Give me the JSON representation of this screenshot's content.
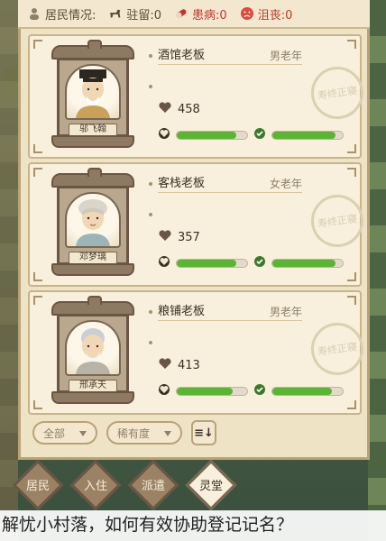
{
  "topbar": {
    "title": "居民情况:",
    "stay": "驻留:0",
    "sick": "患病:0",
    "mourn": "沮丧:0"
  },
  "residents": [
    {
      "name": "邬飞翰",
      "role": "酒馆老板",
      "demo": "男老年",
      "coins": "458",
      "bar1": 0.85,
      "bar2": 0.9,
      "seal": "寿终正寝"
    },
    {
      "name": "邓梦璃",
      "role": "客栈老板",
      "demo": "女老年",
      "coins": "357",
      "bar1": 0.85,
      "bar2": 0.9,
      "seal": "寿终正寝"
    },
    {
      "name": "邢承天",
      "role": "粮铺老板",
      "demo": "男老年",
      "coins": "413",
      "bar1": 0.8,
      "bar2": 0.85,
      "seal": "寿终正寝"
    }
  ],
  "filters": {
    "all": "全部",
    "rarity": "稀有度",
    "sort": "≡↓"
  },
  "tabs": [
    "居民",
    "入住",
    "派遣",
    "灵堂"
  ],
  "caption": "解忧小村落，如何有效协助登记记名？"
}
